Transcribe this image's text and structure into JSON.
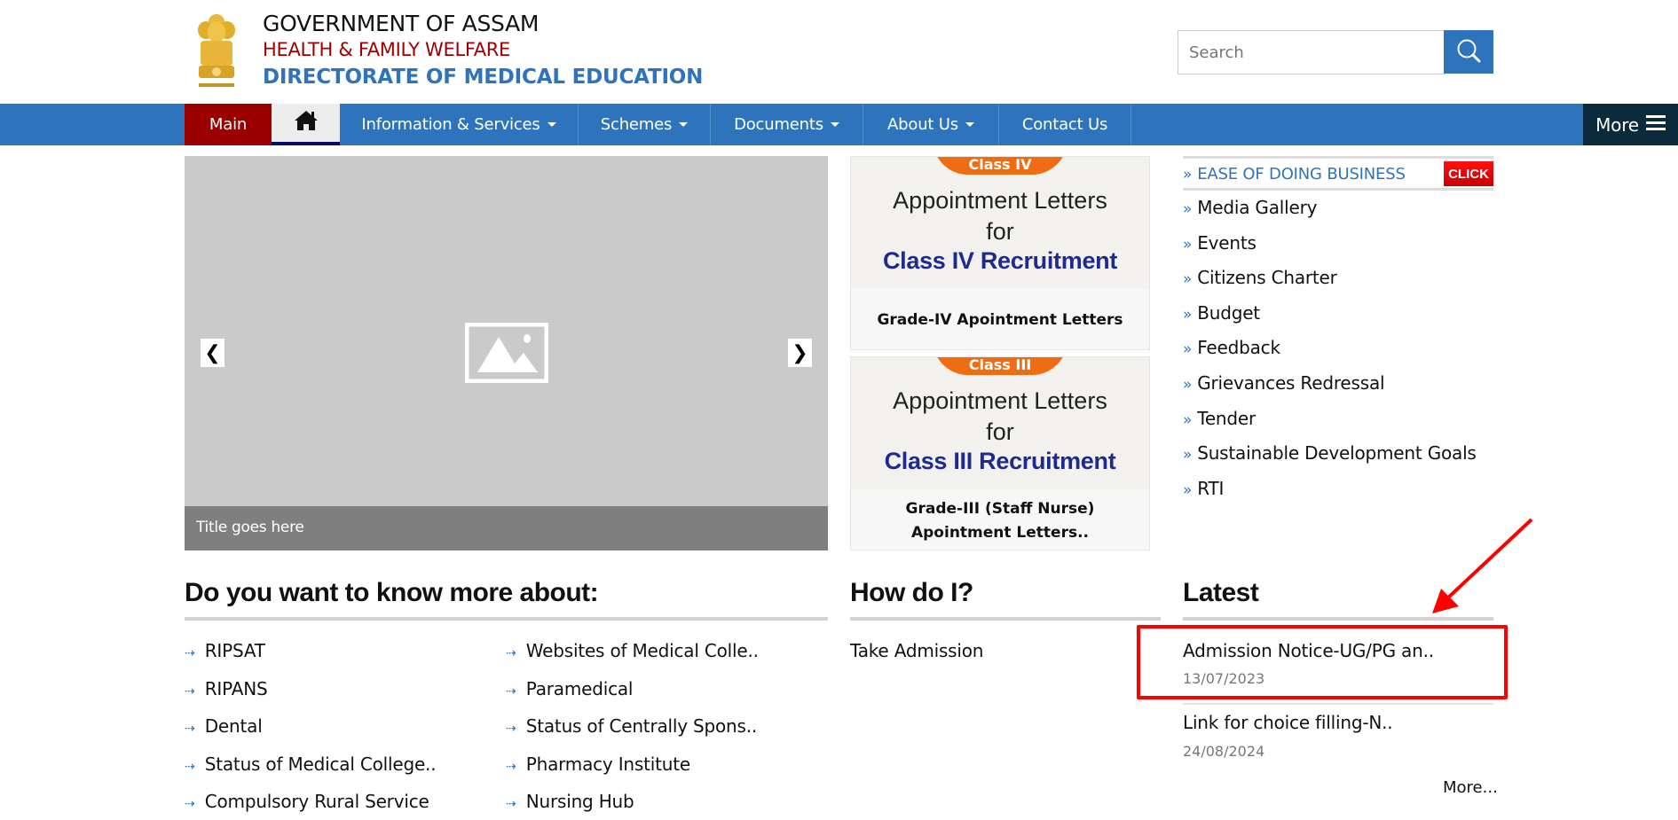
{
  "header": {
    "emblem_icon": "ashoka-emblem-icon",
    "title": "GOVERNMENT OF ASSAM",
    "department": "HEALTH & FAMILY WELFARE",
    "directorate": "DIRECTORATE OF MEDICAL EDUCATION",
    "search": {
      "placeholder": "Search",
      "value": "",
      "button_icon": "search-icon"
    }
  },
  "nav": {
    "items": [
      {
        "label": "Main",
        "dropdown": false
      },
      {
        "label": "",
        "icon": "home-icon",
        "dropdown": false
      },
      {
        "label": "Information & Services",
        "dropdown": true
      },
      {
        "label": "Schemes",
        "dropdown": true
      },
      {
        "label": "Documents",
        "dropdown": true
      },
      {
        "label": "About Us",
        "dropdown": true
      },
      {
        "label": "Contact Us",
        "dropdown": false
      }
    ],
    "more_label": "More",
    "more_icon": "hamburger-icon"
  },
  "slider": {
    "caption": "Title goes here",
    "prev_icon": "chevron-left-icon",
    "next_icon": "chevron-right-icon",
    "placeholder_icon": "image-placeholder-icon"
  },
  "cards": [
    {
      "pill": "Class IV",
      "line1": "Appointment Letters",
      "line2": "for",
      "line3": "Class IV Recruitment",
      "caption": "Grade-IV Apointment Letters"
    },
    {
      "pill": "Class III",
      "line1": "Appointment Letters",
      "line2": "for",
      "line3": "Class III Recruitment",
      "caption": "Grade-III (Staff Nurse) Apointment Letters.."
    }
  ],
  "quick_links": {
    "ease": {
      "label": "EASE OF DOING BUSINESS",
      "badge": "CLICK"
    },
    "bullet": "»",
    "items": [
      "Media Gallery",
      "Events",
      "Citizens Charter",
      "Budget",
      "Feedback",
      "Grievances Redressal",
      "Tender",
      "Sustainable Development Goals",
      "RTI"
    ]
  },
  "know_more": {
    "title": "Do you want to know more about:",
    "bullet": "⇢",
    "col1": [
      "RIPSAT",
      "RIPANS",
      "Dental",
      "Status of Medical College..",
      "Compulsory Rural Service"
    ],
    "col2": [
      "Websites of Medical Colle..",
      "Paramedical",
      "Status of Centrally Spons..",
      "Pharmacy Institute",
      "Nursing Hub"
    ]
  },
  "how_do_i": {
    "title": "How do I?",
    "items": [
      "Take Admission"
    ]
  },
  "latest": {
    "title": "Latest",
    "items": [
      {
        "title": "Admission Notice-UG/PG an..",
        "date": "13/07/2023"
      },
      {
        "title": "Link for choice filling-N..",
        "date": "24/08/2024"
      }
    ],
    "more_label": "More..."
  },
  "colors": {
    "primary_blue": "#2d74bd",
    "main_red": "#9b0000",
    "more_dark": "#0b2a3c",
    "annotation_red": "#ff0000",
    "badge_red": "#e00000",
    "pill_orange": "#ef6c12"
  }
}
